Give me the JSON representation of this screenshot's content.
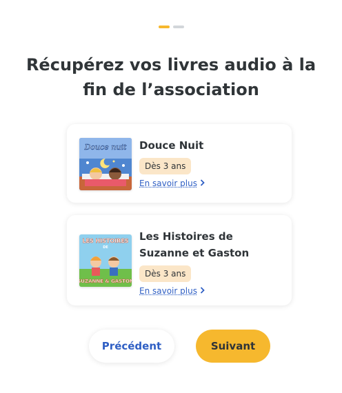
{
  "progress": {
    "current": 1,
    "total": 2
  },
  "title": "Récupérez vos livres audio à la fin de l’association",
  "books": [
    {
      "title": "Douce Nuit",
      "age": "Dès 3 ans",
      "more": "En savoir plus",
      "cover_text": "Douce nuit"
    },
    {
      "title": "Les Histoires de Suzanne et Gaston",
      "age": "Dès 3 ans",
      "more": "En savoir plus",
      "cover_text_top": "LES HISTOIRES",
      "cover_text_mid": "DE",
      "cover_text_bottom": "SUZANNE & GASTON"
    }
  ],
  "buttons": {
    "prev": "Précédent",
    "next": "Suivant"
  },
  "colors": {
    "accent": "#f6b82e",
    "link": "#2f5fc4",
    "badge": "#fbe6c8"
  }
}
